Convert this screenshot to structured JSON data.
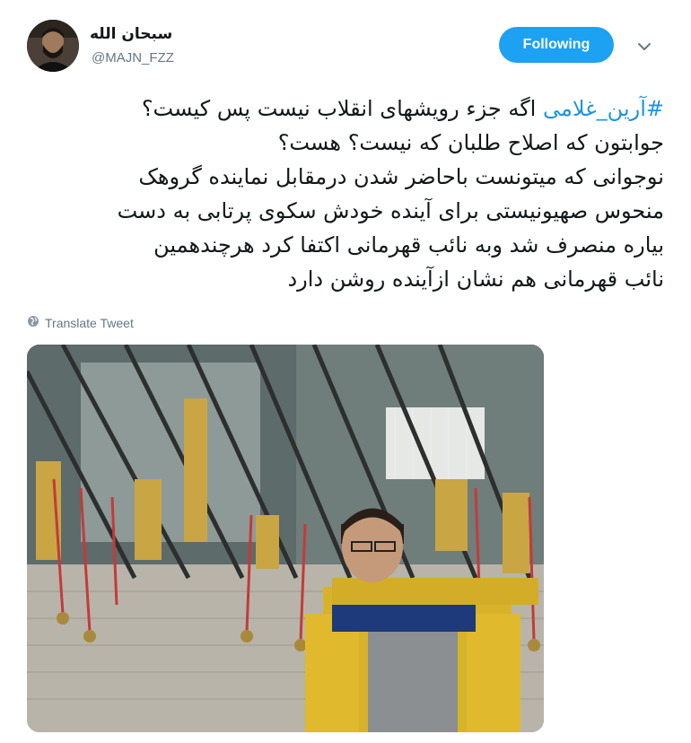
{
  "author": {
    "display_name": "سبحان الله",
    "handle": "@MAJN_FZZ"
  },
  "follow_button_label": "Following",
  "tweet": {
    "hashtag": "#آرین_غلامی",
    "lines": [
      "اگه جزء رویشهای انقلاب نیست پس کیست؟",
      "جوابتون که اصلاح طلبان که نیست؟ هست؟",
      "نوجوانی که میتونست باحاضر شدن درمقابل نماینده گروهک",
      "منحوس صهیونیستی برای آینده خودش سکوی پرتابی به دست",
      "بیاره منصرف شد وبه نائب قهرمانی اکتفا کرد هرچندهمین",
      "نائب قهرمانی هم نشان ازآینده روشن دارد"
    ]
  },
  "translate_label": "Translate Tweet",
  "icons": {
    "caret": "chevron-down-icon",
    "globe": "globe-icon"
  },
  "colors": {
    "accent": "#1da1f2",
    "hashtag": "#1b95e0",
    "secondary_text": "#657786"
  }
}
